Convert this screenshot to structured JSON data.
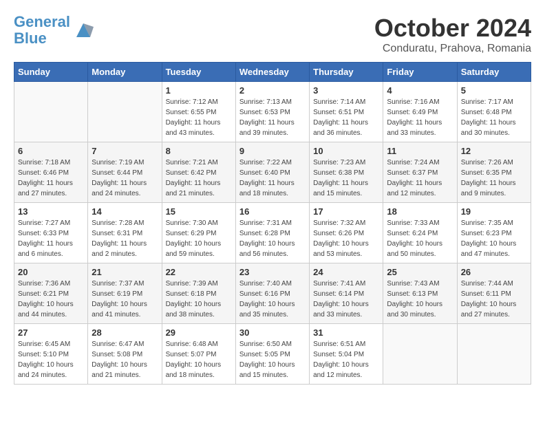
{
  "header": {
    "logo_line1": "General",
    "logo_line2": "Blue",
    "month_title": "October 2024",
    "subtitle": "Conduratu, Prahova, Romania"
  },
  "weekdays": [
    "Sunday",
    "Monday",
    "Tuesday",
    "Wednesday",
    "Thursday",
    "Friday",
    "Saturday"
  ],
  "weeks": [
    [
      null,
      null,
      {
        "day": 1,
        "sunrise": "Sunrise: 7:12 AM",
        "sunset": "Sunset: 6:55 PM",
        "daylight": "Daylight: 11 hours and 43 minutes."
      },
      {
        "day": 2,
        "sunrise": "Sunrise: 7:13 AM",
        "sunset": "Sunset: 6:53 PM",
        "daylight": "Daylight: 11 hours and 39 minutes."
      },
      {
        "day": 3,
        "sunrise": "Sunrise: 7:14 AM",
        "sunset": "Sunset: 6:51 PM",
        "daylight": "Daylight: 11 hours and 36 minutes."
      },
      {
        "day": 4,
        "sunrise": "Sunrise: 7:16 AM",
        "sunset": "Sunset: 6:49 PM",
        "daylight": "Daylight: 11 hours and 33 minutes."
      },
      {
        "day": 5,
        "sunrise": "Sunrise: 7:17 AM",
        "sunset": "Sunset: 6:48 PM",
        "daylight": "Daylight: 11 hours and 30 minutes."
      }
    ],
    [
      {
        "day": 6,
        "sunrise": "Sunrise: 7:18 AM",
        "sunset": "Sunset: 6:46 PM",
        "daylight": "Daylight: 11 hours and 27 minutes."
      },
      {
        "day": 7,
        "sunrise": "Sunrise: 7:19 AM",
        "sunset": "Sunset: 6:44 PM",
        "daylight": "Daylight: 11 hours and 24 minutes."
      },
      {
        "day": 8,
        "sunrise": "Sunrise: 7:21 AM",
        "sunset": "Sunset: 6:42 PM",
        "daylight": "Daylight: 11 hours and 21 minutes."
      },
      {
        "day": 9,
        "sunrise": "Sunrise: 7:22 AM",
        "sunset": "Sunset: 6:40 PM",
        "daylight": "Daylight: 11 hours and 18 minutes."
      },
      {
        "day": 10,
        "sunrise": "Sunrise: 7:23 AM",
        "sunset": "Sunset: 6:38 PM",
        "daylight": "Daylight: 11 hours and 15 minutes."
      },
      {
        "day": 11,
        "sunrise": "Sunrise: 7:24 AM",
        "sunset": "Sunset: 6:37 PM",
        "daylight": "Daylight: 11 hours and 12 minutes."
      },
      {
        "day": 12,
        "sunrise": "Sunrise: 7:26 AM",
        "sunset": "Sunset: 6:35 PM",
        "daylight": "Daylight: 11 hours and 9 minutes."
      }
    ],
    [
      {
        "day": 13,
        "sunrise": "Sunrise: 7:27 AM",
        "sunset": "Sunset: 6:33 PM",
        "daylight": "Daylight: 11 hours and 6 minutes."
      },
      {
        "day": 14,
        "sunrise": "Sunrise: 7:28 AM",
        "sunset": "Sunset: 6:31 PM",
        "daylight": "Daylight: 11 hours and 2 minutes."
      },
      {
        "day": 15,
        "sunrise": "Sunrise: 7:30 AM",
        "sunset": "Sunset: 6:29 PM",
        "daylight": "Daylight: 10 hours and 59 minutes."
      },
      {
        "day": 16,
        "sunrise": "Sunrise: 7:31 AM",
        "sunset": "Sunset: 6:28 PM",
        "daylight": "Daylight: 10 hours and 56 minutes."
      },
      {
        "day": 17,
        "sunrise": "Sunrise: 7:32 AM",
        "sunset": "Sunset: 6:26 PM",
        "daylight": "Daylight: 10 hours and 53 minutes."
      },
      {
        "day": 18,
        "sunrise": "Sunrise: 7:33 AM",
        "sunset": "Sunset: 6:24 PM",
        "daylight": "Daylight: 10 hours and 50 minutes."
      },
      {
        "day": 19,
        "sunrise": "Sunrise: 7:35 AM",
        "sunset": "Sunset: 6:23 PM",
        "daylight": "Daylight: 10 hours and 47 minutes."
      }
    ],
    [
      {
        "day": 20,
        "sunrise": "Sunrise: 7:36 AM",
        "sunset": "Sunset: 6:21 PM",
        "daylight": "Daylight: 10 hours and 44 minutes."
      },
      {
        "day": 21,
        "sunrise": "Sunrise: 7:37 AM",
        "sunset": "Sunset: 6:19 PM",
        "daylight": "Daylight: 10 hours and 41 minutes."
      },
      {
        "day": 22,
        "sunrise": "Sunrise: 7:39 AM",
        "sunset": "Sunset: 6:18 PM",
        "daylight": "Daylight: 10 hours and 38 minutes."
      },
      {
        "day": 23,
        "sunrise": "Sunrise: 7:40 AM",
        "sunset": "Sunset: 6:16 PM",
        "daylight": "Daylight: 10 hours and 35 minutes."
      },
      {
        "day": 24,
        "sunrise": "Sunrise: 7:41 AM",
        "sunset": "Sunset: 6:14 PM",
        "daylight": "Daylight: 10 hours and 33 minutes."
      },
      {
        "day": 25,
        "sunrise": "Sunrise: 7:43 AM",
        "sunset": "Sunset: 6:13 PM",
        "daylight": "Daylight: 10 hours and 30 minutes."
      },
      {
        "day": 26,
        "sunrise": "Sunrise: 7:44 AM",
        "sunset": "Sunset: 6:11 PM",
        "daylight": "Daylight: 10 hours and 27 minutes."
      }
    ],
    [
      {
        "day": 27,
        "sunrise": "Sunrise: 6:45 AM",
        "sunset": "Sunset: 5:10 PM",
        "daylight": "Daylight: 10 hours and 24 minutes."
      },
      {
        "day": 28,
        "sunrise": "Sunrise: 6:47 AM",
        "sunset": "Sunset: 5:08 PM",
        "daylight": "Daylight: 10 hours and 21 minutes."
      },
      {
        "day": 29,
        "sunrise": "Sunrise: 6:48 AM",
        "sunset": "Sunset: 5:07 PM",
        "daylight": "Daylight: 10 hours and 18 minutes."
      },
      {
        "day": 30,
        "sunrise": "Sunrise: 6:50 AM",
        "sunset": "Sunset: 5:05 PM",
        "daylight": "Daylight: 10 hours and 15 minutes."
      },
      {
        "day": 31,
        "sunrise": "Sunrise: 6:51 AM",
        "sunset": "Sunset: 5:04 PM",
        "daylight": "Daylight: 10 hours and 12 minutes."
      },
      null,
      null
    ]
  ]
}
